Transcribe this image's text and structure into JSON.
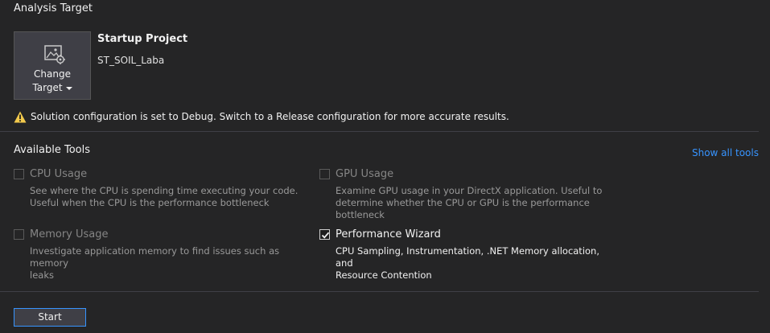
{
  "analysis_target": {
    "title": "Analysis Target",
    "change_target_line1": "Change",
    "change_target_line2": "Target",
    "icon": "change-target-icon",
    "startup_label": "Startup Project",
    "project_name": "ST_SOIL_Laba"
  },
  "warning": {
    "icon": "warning-icon",
    "color": "#f2c94c",
    "text": "Solution configuration is set to Debug. Switch to a Release configuration for more accurate results."
  },
  "available_tools": {
    "title": "Available Tools",
    "show_all": "Show all tools",
    "tools": [
      {
        "name": "CPU Usage",
        "checked": false,
        "enabled": false,
        "desc_lines": [
          "See where the CPU is spending time executing your code.",
          "Useful when the CPU is the performance bottleneck"
        ]
      },
      {
        "name": "GPU Usage",
        "checked": false,
        "enabled": false,
        "desc_lines": [
          "Examine GPU usage in your DirectX application. Useful to",
          "determine whether the CPU or GPU is the performance",
          "bottleneck"
        ]
      },
      {
        "name": "Memory Usage",
        "checked": false,
        "enabled": false,
        "desc_lines": [
          "Investigate application memory to find issues such as memory",
          "leaks"
        ]
      },
      {
        "name": "Performance Wizard",
        "checked": true,
        "enabled": true,
        "desc_lines": [
          "CPU Sampling, Instrumentation, .NET Memory allocation, and",
          "Resource Contention"
        ]
      }
    ]
  },
  "start_button": "Start",
  "colors": {
    "background": "#252526",
    "accent": "#3794ff",
    "divider": "#3f3f46"
  }
}
